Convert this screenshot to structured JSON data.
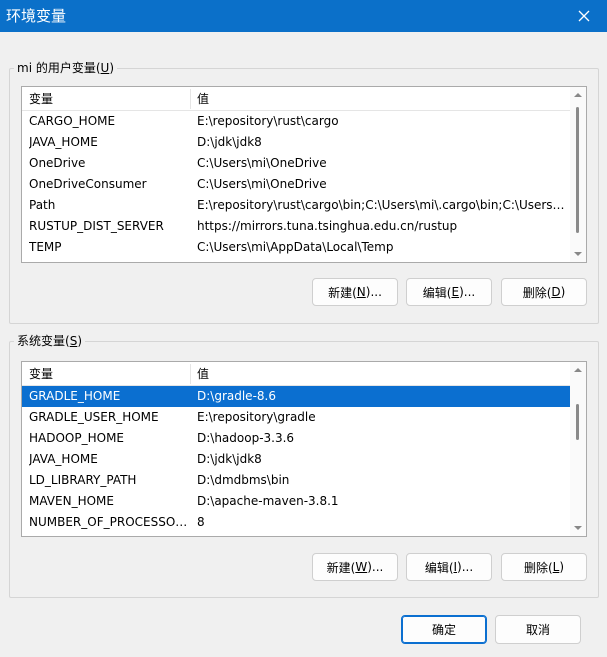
{
  "window": {
    "title": "环境变量",
    "close_icon": "close-icon"
  },
  "user_vars": {
    "group_label_prefix": "mi 的用户变量(",
    "group_label_key": "U",
    "group_label_suffix": ")",
    "header_name": "变量",
    "header_value": "值",
    "rows": [
      {
        "name": "CARGO_HOME",
        "value": "E:\\repository\\rust\\cargo"
      },
      {
        "name": "JAVA_HOME",
        "value": "D:\\jdk\\jdk8"
      },
      {
        "name": "OneDrive",
        "value": "C:\\Users\\mi\\OneDrive"
      },
      {
        "name": "OneDriveConsumer",
        "value": "C:\\Users\\mi\\OneDrive"
      },
      {
        "name": "Path",
        "value": "E:\\repository\\rust\\cargo\\bin;C:\\Users\\mi\\.cargo\\bin;C:\\Users\\..."
      },
      {
        "name": "RUSTUP_DIST_SERVER",
        "value": "https://mirrors.tuna.tsinghua.edu.cn/rustup"
      },
      {
        "name": "TEMP",
        "value": "C:\\Users\\mi\\AppData\\Local\\Temp"
      }
    ],
    "buttons": {
      "new_prefix": "新建(",
      "new_key": "N",
      "new_suffix": ")...",
      "edit_prefix": "编辑(",
      "edit_key": "E",
      "edit_suffix": ")...",
      "delete_prefix": "删除(",
      "delete_key": "D",
      "delete_suffix": ")"
    }
  },
  "system_vars": {
    "group_label_prefix": "系统变量(",
    "group_label_key": "S",
    "group_label_suffix": ")",
    "header_name": "变量",
    "header_value": "值",
    "rows": [
      {
        "name": "GRADLE_HOME",
        "value": "D:\\gradle-8.6",
        "selected": true
      },
      {
        "name": "GRADLE_USER_HOME",
        "value": "E:\\repository\\gradle"
      },
      {
        "name": "HADOOP_HOME",
        "value": "D:\\hadoop-3.3.6"
      },
      {
        "name": "JAVA_HOME",
        "value": "D:\\jdk\\jdk8"
      },
      {
        "name": "LD_LIBRARY_PATH",
        "value": "D:\\dmdbms\\bin"
      },
      {
        "name": "MAVEN_HOME",
        "value": "D:\\apache-maven-3.8.1"
      },
      {
        "name": "NUMBER_OF_PROCESSORS",
        "value": "8"
      }
    ],
    "buttons": {
      "new_prefix": "新建(",
      "new_key": "W",
      "new_suffix": ")...",
      "edit_prefix": "编辑(",
      "edit_key": "I",
      "edit_suffix": ")...",
      "delete_prefix": "删除(",
      "delete_key": "L",
      "delete_suffix": ")"
    }
  },
  "footer": {
    "ok_label": "确定",
    "cancel_label": "取消"
  },
  "colors": {
    "titlebar": "#0b70c9",
    "selection": "#0b6fd0"
  }
}
